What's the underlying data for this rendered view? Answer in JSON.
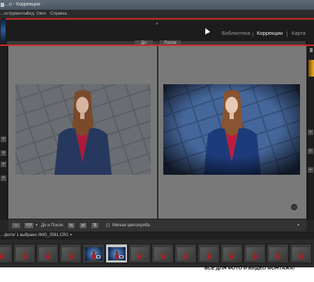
{
  "window": {
    "title": "…o - Коррекции"
  },
  "menu": {
    "items": [
      "…нструменты",
      "Вид",
      "Окно",
      "Справка"
    ]
  },
  "modules": {
    "items": [
      "Библиотека",
      "Коррекции",
      "Карта"
    ],
    "active": "Коррекции"
  },
  "compare": {
    "before_label": "До",
    "after_label": "После"
  },
  "toolbar": {
    "view_mode_label": "Y|Y",
    "mode_label": "До и После",
    "soft_proof_label": "Мягкая цветопроба"
  },
  "filmstrip": {
    "path_text": "…фото/ 1 выбрано /IMG_2561.CR2",
    "thumbnails": [
      {
        "edited": false
      },
      {
        "edited": false
      },
      {
        "edited": false
      },
      {
        "edited": false
      },
      {
        "edited": true
      },
      {
        "edited": true,
        "selected": true
      },
      {
        "edited": false
      },
      {
        "edited": false
      },
      {
        "edited": false
      },
      {
        "edited": false
      },
      {
        "edited": false
      },
      {
        "edited": false
      },
      {
        "edited": false
      },
      {
        "edited": false
      }
    ]
  },
  "watermark": {
    "text": "ВСЕ ДЛЯ ФОТО И ВИДЕО МОНТАЖА!"
  },
  "colors": {
    "highlight_red": "#d22a2a",
    "view_background": "#797979",
    "active_module": "#f0f0f0"
  }
}
